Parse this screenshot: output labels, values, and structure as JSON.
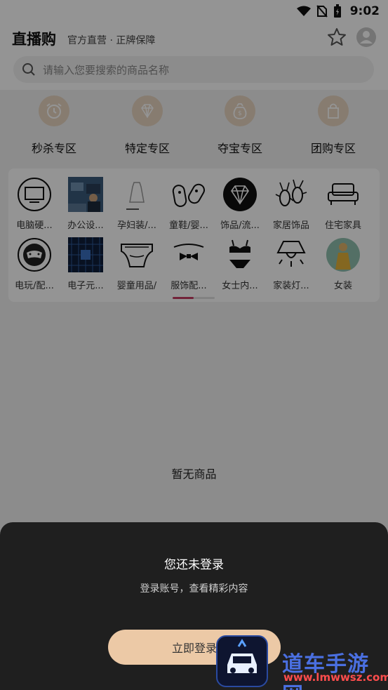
{
  "status_bar": {
    "time": "9:02"
  },
  "header": {
    "title": "直播购",
    "subtitle": "官方直营 · 正牌保障",
    "search_placeholder": "请输入您要搜索的商品名称"
  },
  "zones": [
    {
      "label": "秒杀专区",
      "icon": "alarm-clock-icon"
    },
    {
      "label": "特定专区",
      "icon": "diamond-icon"
    },
    {
      "label": "夺宝专区",
      "icon": "money-bag-icon"
    },
    {
      "label": "团购专区",
      "icon": "shopping-bag-icon"
    }
  ],
  "categories": [
    {
      "label": "电脑硬...",
      "icon": "monitor-icon"
    },
    {
      "label": "办公设...",
      "icon": "office-photo"
    },
    {
      "label": "孕妇装/...",
      "icon": "maternity-dress-icon"
    },
    {
      "label": "童鞋/婴...",
      "icon": "baby-shoes-icon"
    },
    {
      "label": "饰品/流...",
      "icon": "diamond-icon"
    },
    {
      "label": "家居饰品",
      "icon": "bugs-icon"
    },
    {
      "label": "住宅家具",
      "icon": "sofa-icon"
    },
    {
      "label": "电玩/配...",
      "icon": "gamepad-icon"
    },
    {
      "label": "电子元...",
      "icon": "electronics-photo"
    },
    {
      "label": "婴童用品/",
      "icon": "diaper-icon"
    },
    {
      "label": "服饰配...",
      "icon": "bow-tie-icon"
    },
    {
      "label": "女士内...",
      "icon": "lingerie-icon"
    },
    {
      "label": "家装灯...",
      "icon": "lamp-icon"
    },
    {
      "label": "女装",
      "icon": "womens-wear-photo"
    }
  ],
  "empty_text": "暂无商品",
  "login_sheet": {
    "title": "您还未登录",
    "subtitle": "登录账号，查看精彩内容",
    "button": "立即登录"
  },
  "watermark": {
    "text": "道车手游网",
    "url": "www.lmwwsz.com"
  },
  "colors": {
    "accent_gold": "#ecc9a6",
    "indicator": "#c53d62",
    "sheet_bg": "#1f1f1f"
  }
}
